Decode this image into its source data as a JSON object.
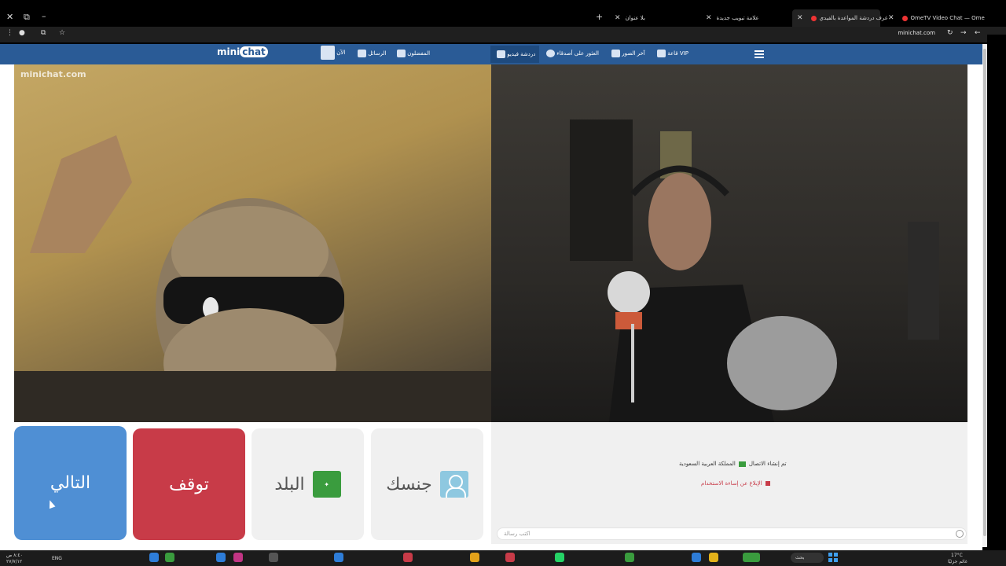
{
  "browser": {
    "tabs": [
      {
        "title": "OmeTV Video Chat — Ome",
        "active": false
      },
      {
        "title": "غرف دردشة المواعدة بالفيدي",
        "active": true
      },
      {
        "title": "علامة تبويب جديدة",
        "active": false
      },
      {
        "title": "بلا عنوان",
        "active": false
      }
    ],
    "url": "minichat.com",
    "new_tab_label": "+",
    "window_close": "✕",
    "window_restore": "⧉",
    "window_minimize": "–"
  },
  "site": {
    "logo_mini": "mini",
    "logo_chat": "chat",
    "nav": {
      "online": "الآن",
      "messages": "الرسائل",
      "followers": "المفضلون",
      "video_chat": "دردشة فيديو",
      "search": "العثور على أصدقاء",
      "photos": "آخر الصور",
      "vip": "قاعة VIP"
    },
    "watermark": "minichat.com"
  },
  "controls": {
    "next": "التالي",
    "stop": "توقف",
    "country": "البلد",
    "gender": "جنسك"
  },
  "chat": {
    "status": "تم إنشاء الاتصال",
    "country": "المملكة العربية السعودية",
    "report": "الإبلاغ عن إساءة الاستخدام",
    "input_placeholder": "اكتب رسالة"
  },
  "taskbar": {
    "search": "بحث",
    "weather_temp": "17°C",
    "weather_text": "غائم جزئيًا",
    "lang": "ENG",
    "time": "٨:٤٠ ص",
    "date": "٢٧/٧/١٢"
  },
  "colors": {
    "nav": "#2a5b96",
    "next": "#4f8fd4",
    "stop": "#c83b48",
    "flag": "#3a9c3e"
  }
}
